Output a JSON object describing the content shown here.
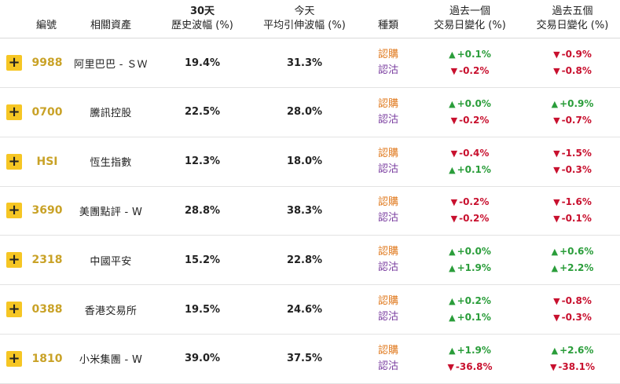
{
  "headers": {
    "code": "編號",
    "asset": "相關資產",
    "hv_line1": "30天",
    "hv_line2": "歷史波幅 (%)",
    "iv_line1": "今天",
    "iv_line2": "平均引伸波幅 (%)",
    "type": "種類",
    "d1_line1": "過去一個",
    "d1_line2": "交易日變化 (%)",
    "d5_line1": "過去五個",
    "d5_line2": "交易日變化 (%)"
  },
  "plus_symbol": "+",
  "type_labels": {
    "call": "認購",
    "put": "認沽"
  },
  "colors": {
    "code": "#c9a227",
    "plus": "#f6c624",
    "call": "#e07a1f",
    "put": "#7b3fa0",
    "up": "#2a9d3a",
    "down": "#c8102e"
  },
  "rows": [
    {
      "code": "9988",
      "asset": "阿里巴巴 - ＳＷ",
      "hv": "19.4%",
      "iv": "31.3%",
      "call_d1": {
        "dir": "up",
        "text": "+0.1%"
      },
      "put_d1": {
        "dir": "down",
        "text": "-0.2%"
      },
      "call_d5": {
        "dir": "down",
        "text": "-0.9%"
      },
      "put_d5": {
        "dir": "down",
        "text": "-0.8%"
      }
    },
    {
      "code": "0700",
      "asset": "騰訊控股",
      "hv": "22.5%",
      "iv": "28.0%",
      "call_d1": {
        "dir": "up",
        "text": "+0.0%"
      },
      "put_d1": {
        "dir": "down",
        "text": "-0.2%"
      },
      "call_d5": {
        "dir": "up",
        "text": "+0.9%"
      },
      "put_d5": {
        "dir": "down",
        "text": "-0.7%"
      }
    },
    {
      "code": "HSI",
      "asset": "恆生指數",
      "hv": "12.3%",
      "iv": "18.0%",
      "call_d1": {
        "dir": "down",
        "text": "-0.4%"
      },
      "put_d1": {
        "dir": "up",
        "text": "+0.1%"
      },
      "call_d5": {
        "dir": "down",
        "text": "-1.5%"
      },
      "put_d5": {
        "dir": "down",
        "text": "-0.3%"
      }
    },
    {
      "code": "3690",
      "asset": "美團點評 - W",
      "hv": "28.8%",
      "iv": "38.3%",
      "call_d1": {
        "dir": "down",
        "text": "-0.2%"
      },
      "put_d1": {
        "dir": "down",
        "text": "-0.2%"
      },
      "call_d5": {
        "dir": "down",
        "text": "-1.6%"
      },
      "put_d5": {
        "dir": "down",
        "text": "-0.1%"
      }
    },
    {
      "code": "2318",
      "asset": "中國平安",
      "hv": "15.2%",
      "iv": "22.8%",
      "call_d1": {
        "dir": "up",
        "text": "+0.0%"
      },
      "put_d1": {
        "dir": "up",
        "text": "+1.9%"
      },
      "call_d5": {
        "dir": "up",
        "text": "+0.6%"
      },
      "put_d5": {
        "dir": "up",
        "text": "+2.2%"
      }
    },
    {
      "code": "0388",
      "asset": "香港交易所",
      "hv": "19.5%",
      "iv": "24.6%",
      "call_d1": {
        "dir": "up",
        "text": "+0.2%"
      },
      "put_d1": {
        "dir": "up",
        "text": "+0.1%"
      },
      "call_d5": {
        "dir": "down",
        "text": "-0.8%"
      },
      "put_d5": {
        "dir": "down",
        "text": "-0.3%"
      }
    },
    {
      "code": "1810",
      "asset": "小米集團 - W",
      "hv": "39.0%",
      "iv": "37.5%",
      "call_d1": {
        "dir": "up",
        "text": "+1.9%"
      },
      "put_d1": {
        "dir": "down",
        "text": "-36.8%"
      },
      "call_d5": {
        "dir": "up",
        "text": "+2.6%"
      },
      "put_d5": {
        "dir": "down",
        "text": "-38.1%"
      }
    }
  ]
}
